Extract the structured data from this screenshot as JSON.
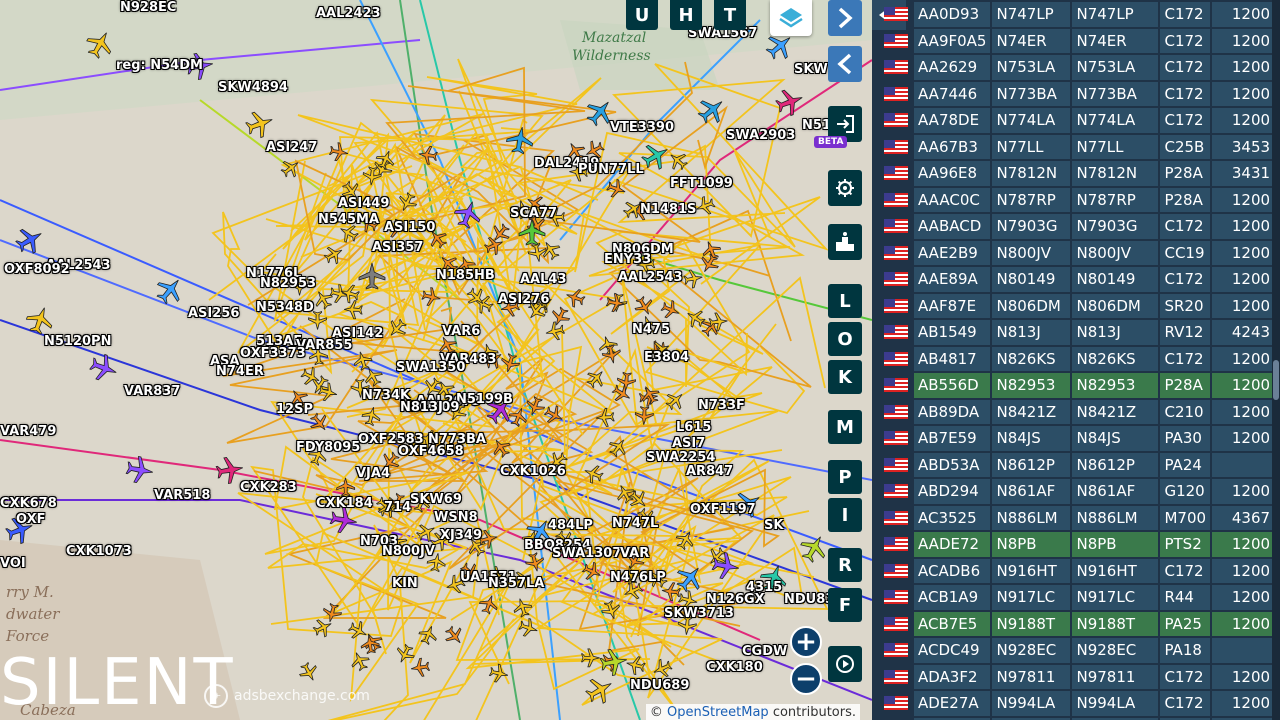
{
  "map": {
    "places": [
      {
        "text": "Mazatzal",
        "green": true
      },
      {
        "text": "Wilderness",
        "green": true
      },
      {
        "text": "rry M.",
        "green": false
      },
      {
        "text": "dwater",
        "green": false
      },
      {
        "text": "Force",
        "green": false
      },
      {
        "text": "Cabeza",
        "green": false
      }
    ],
    "callsigns": [
      "N928EC",
      "AAL2423",
      "SWA1567",
      "SKW",
      "reg: N54DM",
      "SKW4894",
      "N51",
      "AAL2543",
      "SWA2903",
      "VTE3390",
      "ASI247",
      "DAL2419",
      "PUN77LL",
      "FFT1099",
      "ASI449",
      "N545MA",
      "ASI150",
      "SCA77",
      "N1481S",
      "ASI357",
      "N806DM",
      "OXF8092",
      "N1776L",
      "N185HB",
      "ENY33",
      "N82953",
      "AAL2543",
      "ASI256",
      "N5348D",
      "AAL43",
      "ASI276",
      "513AF",
      "N5120PN",
      "ASI142",
      "VAR855",
      "VAR6",
      "N475",
      "ASA",
      "OXF3373",
      "VAR483",
      "E3804",
      "N74ER",
      "VAR837",
      "SWA1350",
      "N734K",
      "AAL2673",
      "N5199B",
      "12SP",
      "N733F",
      "VAR479",
      "OXF2583",
      "L615",
      "N773BA",
      "FDY8095",
      "OXF4658",
      "ASI7",
      "VAR518",
      "CXK283",
      "SWA2254",
      "VJA4",
      "CXK1026",
      "AR847",
      "CXK678",
      "CXK184",
      "714",
      "SKW69",
      "SK",
      "OXF",
      "WSN8",
      "484LP",
      "XJ349",
      "N747L",
      "OXF1197",
      "CXK1073",
      "N703",
      "BBQ8254",
      "SWA1307",
      "VAR",
      "VOI",
      "N800JV",
      "4315",
      "KIN",
      "UA1571",
      "N357LA",
      "N476LP",
      "N126GX",
      "NDU834",
      "SKW3713",
      "CGDW",
      "CXK180",
      "NDU689",
      "NDU609",
      "N813J"
    ],
    "silent_text": "SILENT",
    "watermark": "adsbexchange.com",
    "attribution_prefix": "©",
    "attribution_link": "OpenStreetMap",
    "attribution_suffix": "contributors.",
    "beta": "BETA",
    "top_buttons": [
      "U",
      "H",
      "T"
    ],
    "side_buttons": [
      "L",
      "O",
      "K",
      "M",
      "P",
      "I",
      "R",
      "F"
    ],
    "zoom_in": "+",
    "zoom_out": "−"
  },
  "panel": {
    "rows": [
      [
        "AA0D93",
        "N747LP",
        "N747LP",
        "C172",
        "1200"
      ],
      [
        "AA9F0A5",
        "N74ER",
        "N74ER",
        "C172",
        "1200"
      ],
      [
        "AA2629",
        "N753LA",
        "N753LA",
        "C172",
        "1200"
      ],
      [
        "AA7446",
        "N773BA",
        "N773BA",
        "C172",
        "1200"
      ],
      [
        "AA78DE",
        "N774LA",
        "N774LA",
        "C172",
        "1200"
      ],
      [
        "AA67B3",
        "N77LL",
        "N77LL",
        "C25B",
        "3453"
      ],
      [
        "AA96E8",
        "N7812N",
        "N7812N",
        "P28A",
        "3431"
      ],
      [
        "AAAC0C",
        "N787RP",
        "N787RP",
        "P28A",
        "1200"
      ],
      [
        "AABACD",
        "N7903G",
        "N7903G",
        "C172",
        "1200"
      ],
      [
        "AAE2B9",
        "N800JV",
        "N800JV",
        "CC19",
        "1200"
      ],
      [
        "AAE89A",
        "N80149",
        "N80149",
        "C172",
        "1200"
      ],
      [
        "AAF87E",
        "N806DM",
        "N806DM",
        "SR20",
        "1200"
      ],
      [
        "AB1549",
        "N813J",
        "N813J",
        "RV12",
        "4243"
      ],
      [
        "AB4817",
        "N826KS",
        "N826KS",
        "C172",
        "1200"
      ],
      [
        "AB556D",
        "N82953",
        "N82953",
        "P28A",
        "1200"
      ],
      [
        "AB89DA",
        "N8421Z",
        "N8421Z",
        "C210",
        "1200"
      ],
      [
        "AB7E59",
        "N84JS",
        "N84JS",
        "PA30",
        "1200"
      ],
      [
        "ABD53A",
        "N8612P",
        "N8612P",
        "PA24",
        ""
      ],
      [
        "ABD294",
        "N861AF",
        "N861AF",
        "G120",
        "1200"
      ],
      [
        "AC3525",
        "N886LM",
        "N886LM",
        "M700",
        "4367"
      ],
      [
        "AADE72",
        "N8PB",
        "N8PB",
        "PTS2",
        "1200"
      ],
      [
        "ACADB6",
        "N916HT",
        "N916HT",
        "C172",
        "1200"
      ],
      [
        "ACB1A9",
        "N917LC",
        "N917LC",
        "R44",
        "1200"
      ],
      [
        "ACB7E5",
        "N9188T",
        "N9188T",
        "PA25",
        "1200"
      ],
      [
        "ACDC49",
        "N928EC",
        "N928EC",
        "PA18",
        ""
      ],
      [
        "ADA3F2",
        "N97811",
        "N97811",
        "C172",
        "1200"
      ],
      [
        "ADE27A",
        "N994LA",
        "N994LA",
        "C172",
        "1200"
      ],
      [
        "",
        "",
        "",
        "",
        ""
      ]
    ],
    "highlighted_rows": [
      14,
      20,
      23
    ]
  },
  "colors": {
    "panel_bg": "#1f3347",
    "cell_bg": "#2c4e66",
    "cell_highlight": "#3a7a4b",
    "button_bg": "#00363f",
    "aircraft_yellow": "#f3c41e",
    "aircraft_orange": "#f08a1c"
  }
}
